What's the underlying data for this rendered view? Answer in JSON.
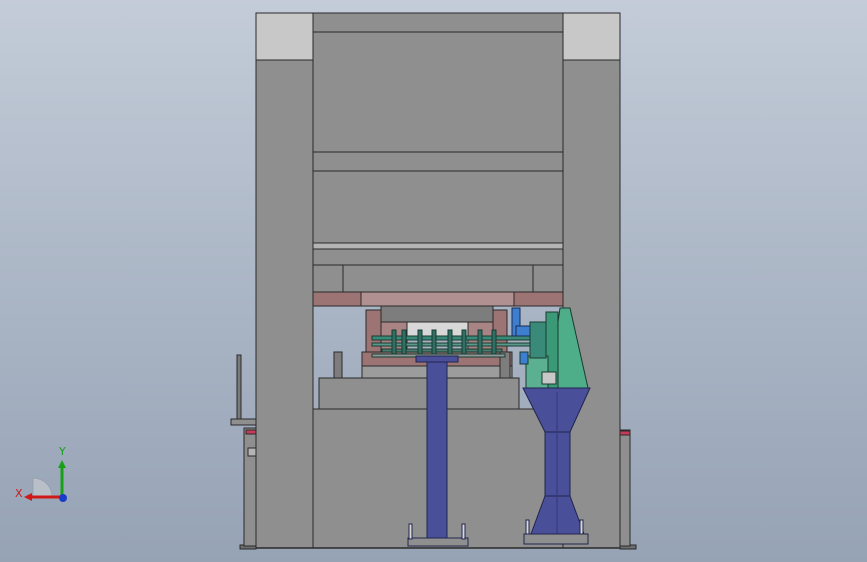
{
  "viewport": {
    "background_top": "#c3ccd8",
    "background_bottom": "#96a3b5"
  },
  "colors": {
    "frame_gray": "#8f8f8f",
    "frame_light": "#c8c8c8",
    "frame_dark": "#6e6e6e",
    "outline": "#2a2a2a",
    "die_rose": "#9c7474",
    "column_blue": "#4a4f9a",
    "column_blue_dark": "#34387a",
    "bracket_green": "#4fae8a",
    "feeder_teal": "#3a8a7a",
    "motor_blue": "#3c7fd0",
    "accent_red": "#c83a5a"
  },
  "triad": {
    "x_label": "X",
    "y_label": "Y",
    "x_axis_color": "#d01818",
    "y_axis_color": "#18a018",
    "z_axis_color": "#1a3cc8"
  }
}
